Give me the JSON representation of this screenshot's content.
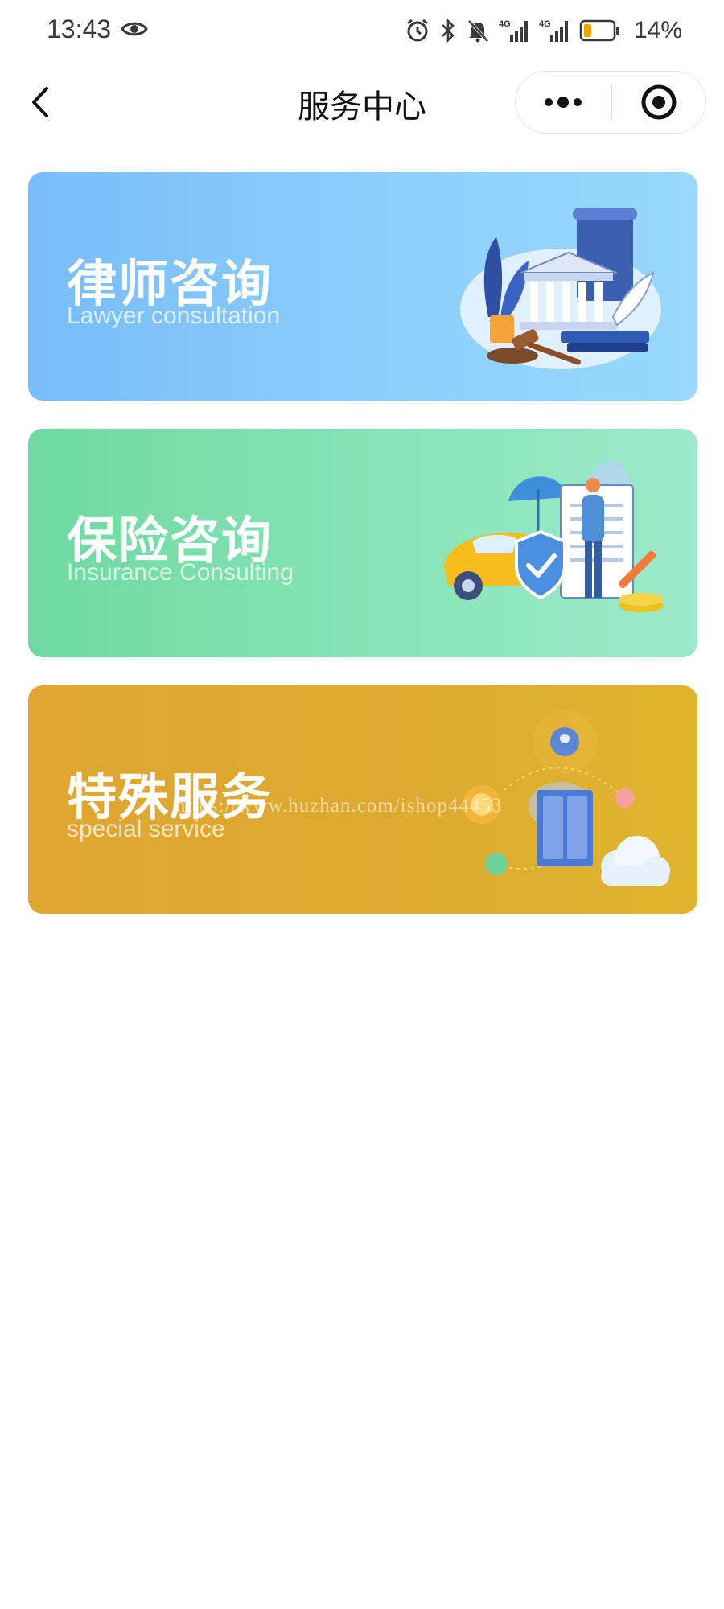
{
  "status_bar": {
    "time": "13:43",
    "battery_percent": "14%",
    "network_labels": [
      "4G",
      "4G"
    ],
    "battery_level": 0.14,
    "icons": [
      "eye-icon",
      "alarm-icon",
      "bluetooth-icon",
      "bell-off-icon",
      "signal-icon",
      "signal-icon",
      "battery-icon"
    ]
  },
  "nav": {
    "title": "服务中心",
    "back_icon": "chevron-left-icon",
    "more_icon": "more-dots-icon",
    "close_icon": "target-close-icon"
  },
  "cards": [
    {
      "title": "律师咨询",
      "subtitle": "Lawyer consultation",
      "illustration": "courthouse-books-gavel-illustration",
      "color": "#8cc8fb"
    },
    {
      "title": "保险咨询",
      "subtitle": "Insurance Consulting",
      "illustration": "car-shield-document-illustration",
      "color": "#82e0b0"
    },
    {
      "title": "特殊服务",
      "subtitle": "special service",
      "illustration": "server-cloud-network-illustration",
      "color": "#ddab30"
    }
  ],
  "watermark": "https://www.huzhan.com/ishop44453"
}
